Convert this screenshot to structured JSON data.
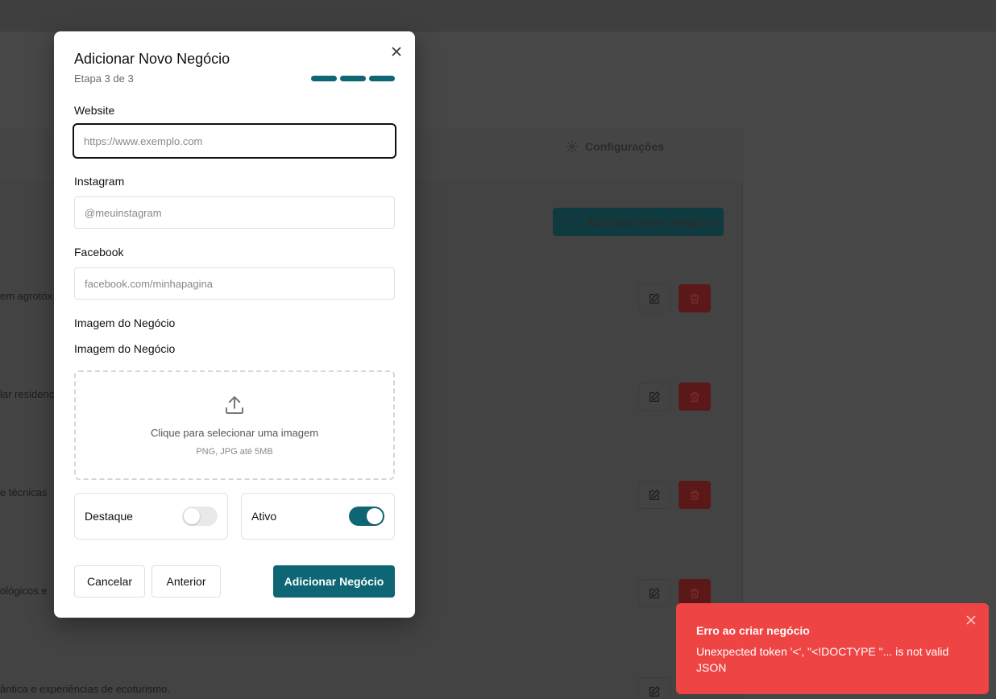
{
  "background": {
    "tab_config_label": "Configurações",
    "add_button_label": "Adicionar Novo Negócio",
    "rows": [
      {
        "text": "em agrotóx"
      },
      {
        "text": "lar residenc"
      },
      {
        "text": "e técnicas"
      },
      {
        "text": "ológicos e"
      },
      {
        "text": "ântica e experiências de ecoturismo."
      }
    ]
  },
  "modal": {
    "title": "Adicionar Novo Negócio",
    "step": "Etapa 3 de 3",
    "progress_steps": 3,
    "progress_current": 3,
    "website": {
      "label": "Website",
      "placeholder": "https://www.exemplo.com",
      "value": ""
    },
    "instagram": {
      "label": "Instagram",
      "placeholder": "@meuinstagram",
      "value": ""
    },
    "facebook": {
      "label": "Facebook",
      "placeholder": "facebook.com/minhapagina",
      "value": ""
    },
    "image_section_label": "Imagem do Negócio",
    "image_field_label": "Imagem do Negócio",
    "dropzone": {
      "text": "Clique para selecionar uma imagem",
      "hint": "PNG, JPG até 5MB"
    },
    "toggles": {
      "featured": {
        "label": "Destaque",
        "checked": false
      },
      "active": {
        "label": "Ativo",
        "checked": true
      }
    },
    "buttons": {
      "cancel": "Cancelar",
      "previous": "Anterior",
      "submit": "Adicionar Negócio"
    }
  },
  "toast": {
    "title": "Erro ao criar negócio",
    "description": "Unexpected token '<', \"<!DOCTYPE \"... is not valid JSON",
    "color": "#ef4444"
  },
  "colors": {
    "accent": "#0e6674",
    "danger": "#ef4444",
    "overlay": "#474747"
  }
}
